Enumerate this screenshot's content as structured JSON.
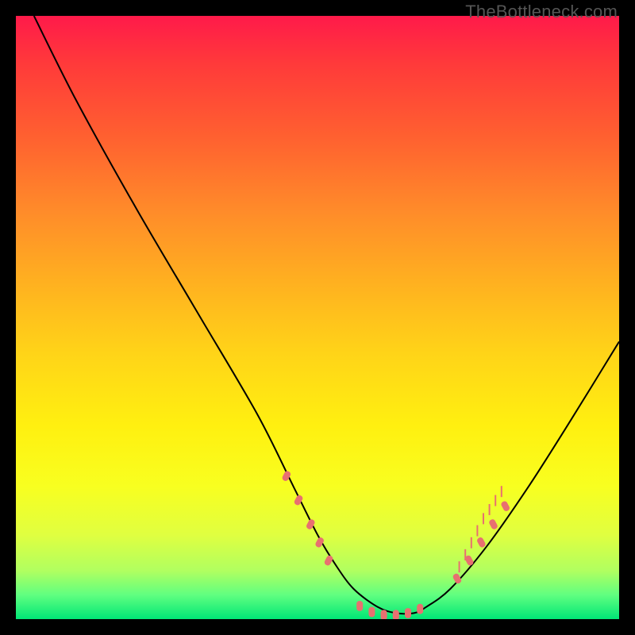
{
  "watermark": "TheBottleneck.com",
  "chart_data": {
    "type": "line",
    "title": "",
    "xlabel": "",
    "ylabel": "",
    "xlim": [
      0,
      100
    ],
    "ylim": [
      0,
      100
    ],
    "grid": false,
    "legend": false,
    "series": [
      {
        "name": "curve",
        "x": [
          3,
          10,
          20,
          30,
          40,
          46,
          50,
          53,
          56,
          60,
          63,
          66,
          68,
          72,
          78,
          85,
          92,
          100
        ],
        "y": [
          100,
          86,
          68,
          51,
          34,
          22,
          14,
          9,
          5,
          2,
          1,
          1,
          2,
          5,
          12,
          22,
          33,
          46
        ],
        "stroke": "#000000",
        "stroke_width": 2
      }
    ],
    "markers": [
      {
        "name": "left-markers",
        "x": [
          45,
          47,
          49,
          50.5,
          52
        ],
        "y": [
          24,
          20,
          16,
          13,
          10
        ],
        "color": "#e87070",
        "size": 8
      },
      {
        "name": "bottom-markers",
        "x": [
          57,
          59,
          61,
          63,
          65,
          67
        ],
        "y": [
          2.5,
          1.5,
          1,
          1,
          1.3,
          2
        ],
        "color": "#e87070",
        "size": 8
      },
      {
        "name": "right-markers",
        "x": [
          73,
          75,
          77,
          79,
          81
        ],
        "y": [
          7,
          10,
          13,
          16,
          19
        ],
        "color": "#e87070",
        "size": 8
      }
    ],
    "tick_marks": {
      "x": [
        73.5,
        74.5,
        75.5,
        76.5,
        77.5,
        78.5,
        79.5,
        80.5
      ],
      "y_base": [
        8,
        10,
        12,
        14,
        16,
        17.5,
        19,
        20.5
      ],
      "len": 3,
      "color": "#e87070"
    }
  }
}
